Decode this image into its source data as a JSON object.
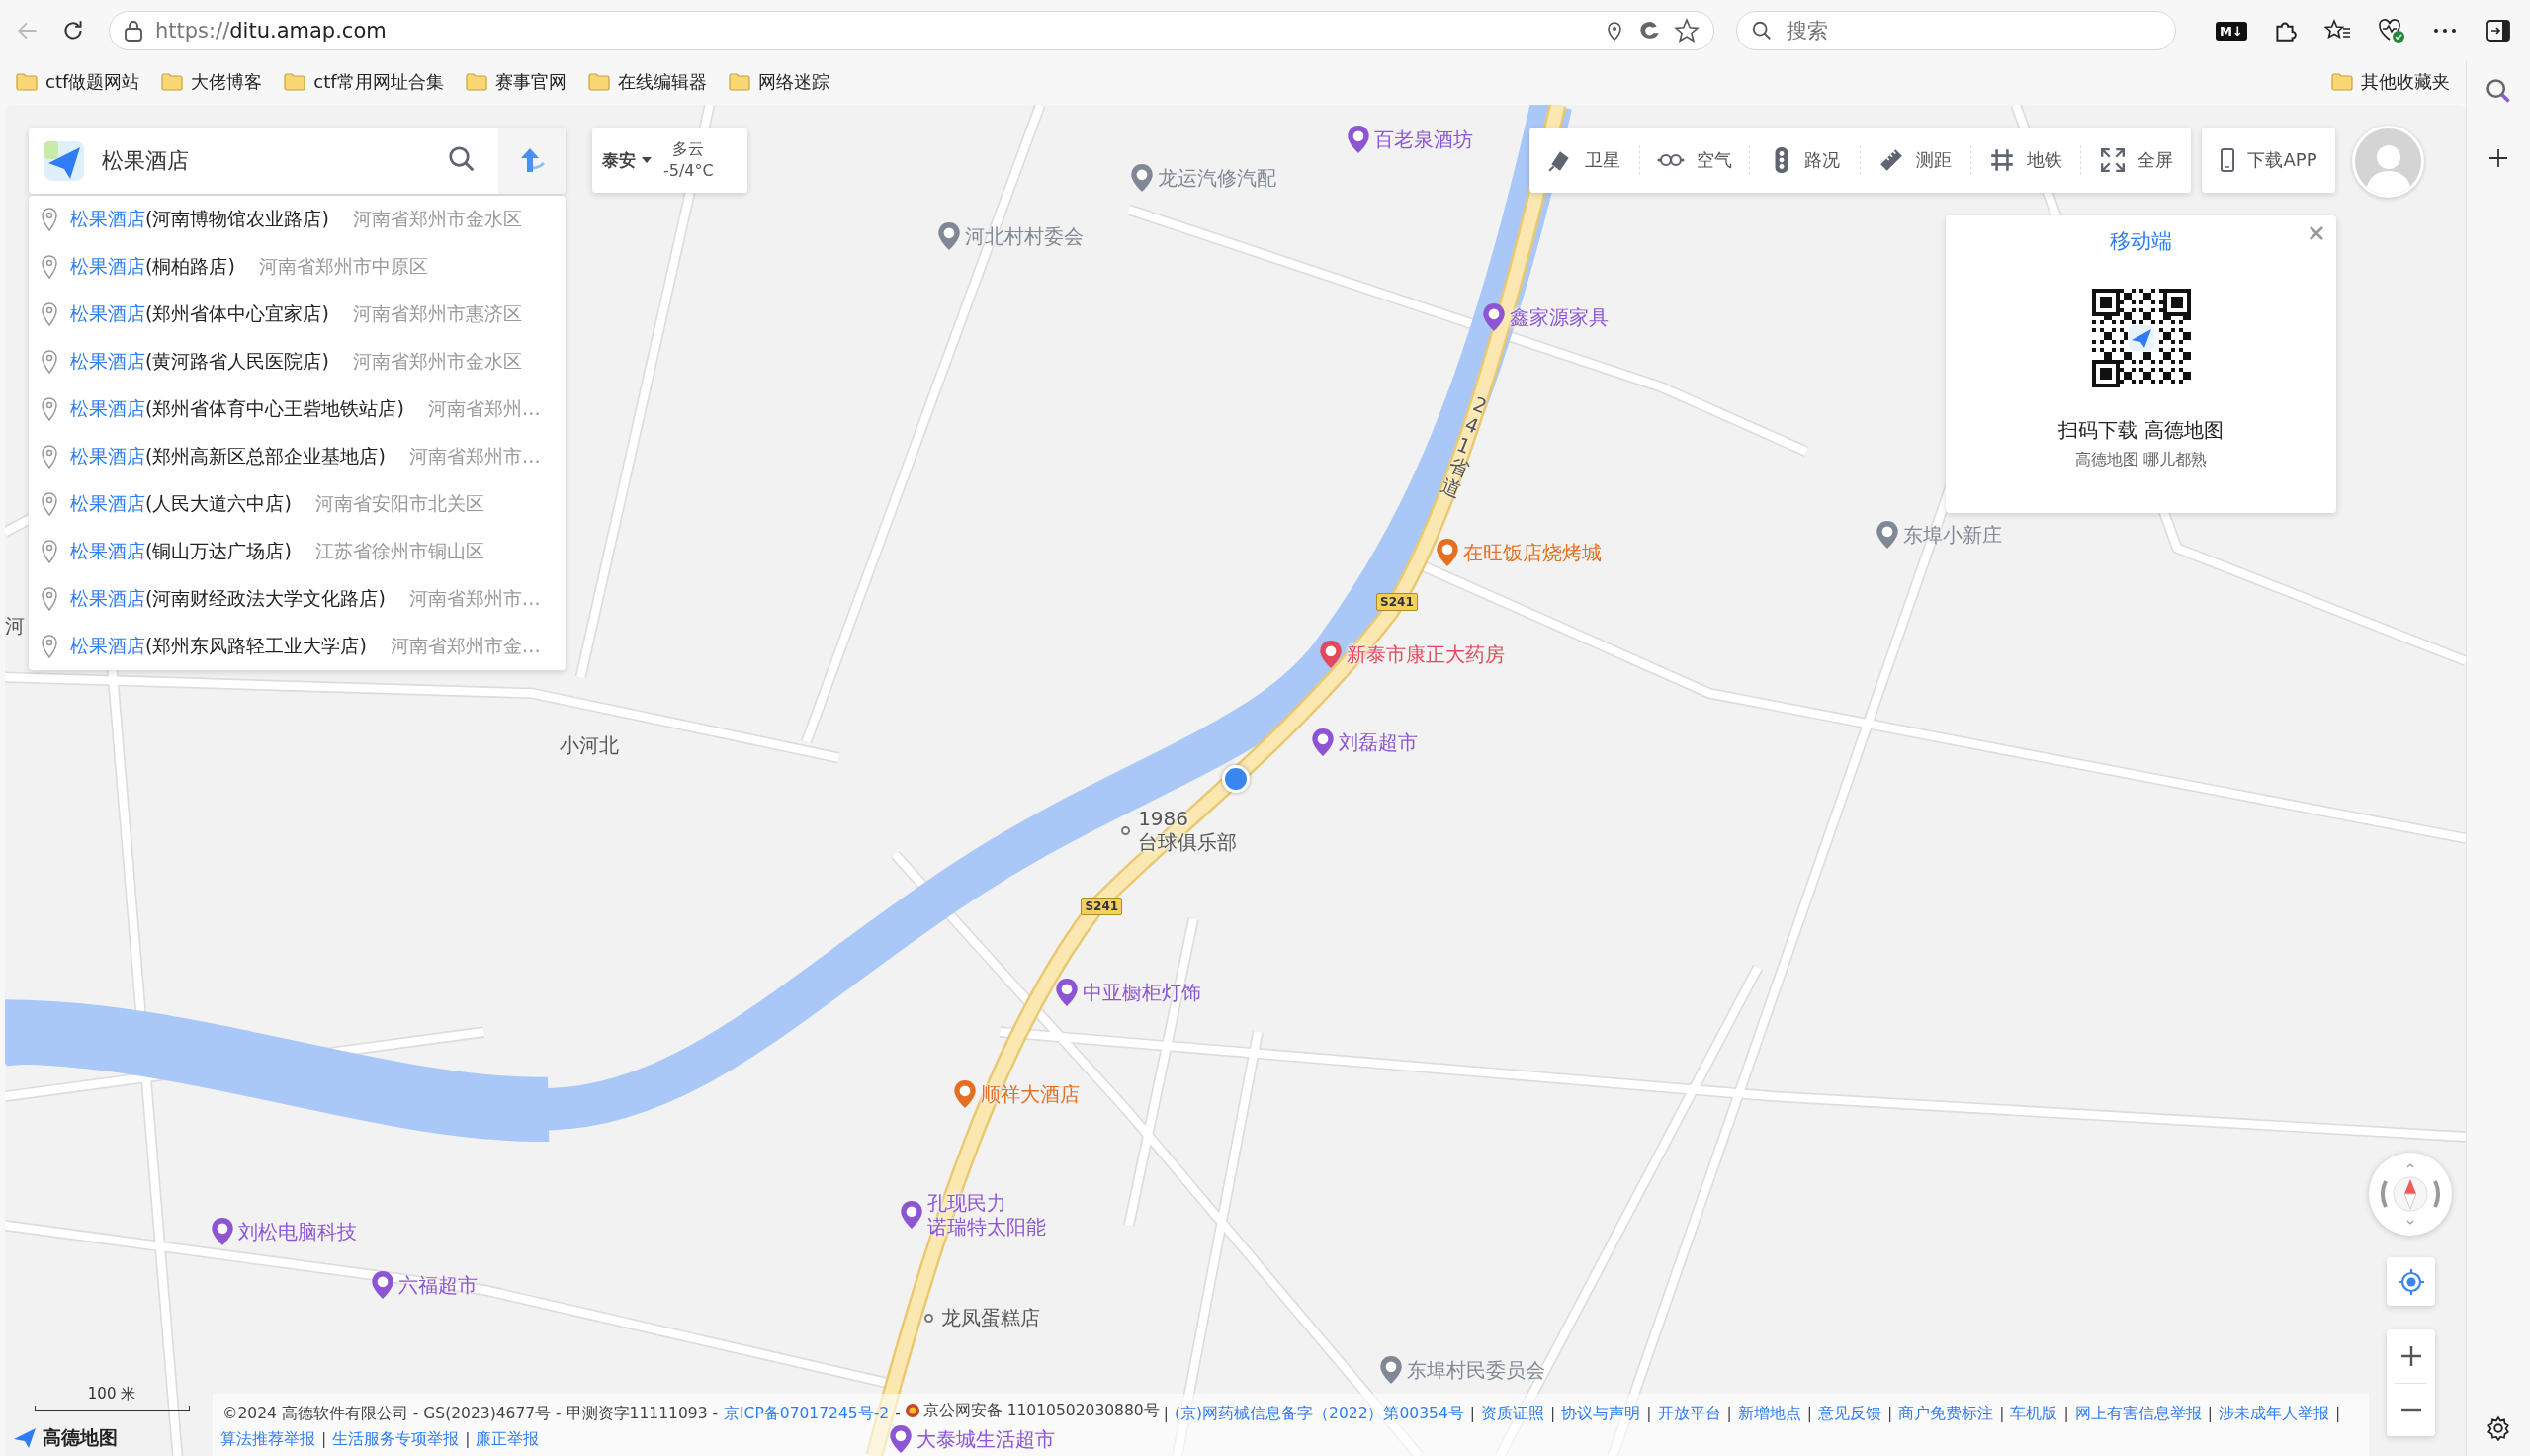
{
  "browser": {
    "back_disabled": true,
    "url_scheme": "https://",
    "url_host": "ditu.amap.com",
    "search_placeholder": "搜索",
    "extension_label": "M↓"
  },
  "bookmarks": [
    {
      "label": "ctf做题网站"
    },
    {
      "label": "大佬博客"
    },
    {
      "label": "ctf常用网址合集"
    },
    {
      "label": "赛事官网"
    },
    {
      "label": "在线编辑器"
    },
    {
      "label": "网络迷踪"
    }
  ],
  "other_bookmarks": "其他收藏夹",
  "search": {
    "value": "松果酒店"
  },
  "suggestions": [
    {
      "match": "松果酒店",
      "detail": "(河南博物馆农业路店)",
      "address": "河南省郑州市金水区"
    },
    {
      "match": "松果酒店",
      "detail": "(桐柏路店)",
      "address": "河南省郑州市中原区"
    },
    {
      "match": "松果酒店",
      "detail": "(郑州省体中心宜家店)",
      "address": "河南省郑州市惠济区"
    },
    {
      "match": "松果酒店",
      "detail": "(黄河路省人民医院店)",
      "address": "河南省郑州市金水区"
    },
    {
      "match": "松果酒店",
      "detail": "(郑州省体育中心王砦地铁站店)",
      "address": "河南省郑州…"
    },
    {
      "match": "松果酒店",
      "detail": "(郑州高新区总部企业基地店)",
      "address": "河南省郑州市…"
    },
    {
      "match": "松果酒店",
      "detail": "(人民大道六中店)",
      "address": "河南省安阳市北关区"
    },
    {
      "match": "松果酒店",
      "detail": "(铜山万达广场店)",
      "address": "江苏省徐州市铜山区"
    },
    {
      "match": "松果酒店",
      "detail": "(河南财经政法大学文化路店)",
      "address": "河南省郑州市…"
    },
    {
      "match": "松果酒店",
      "detail": "(郑州东风路轻工业大学店)",
      "address": "河南省郑州市金…"
    }
  ],
  "weather": {
    "city": "泰安",
    "condition": "多云",
    "temperature": "-5/4°C"
  },
  "toolbar": [
    {
      "kind": "satellite",
      "label": "卫星"
    },
    {
      "kind": "air",
      "label": "空气"
    },
    {
      "kind": "traffic",
      "label": "路况"
    },
    {
      "kind": "ruler",
      "label": "测距"
    },
    {
      "kind": "subway",
      "label": "地铁"
    },
    {
      "kind": "fullscreen",
      "label": "全屏"
    }
  ],
  "download_button": "下载APP",
  "qr_card": {
    "title": "移动端",
    "headline": "扫码下载 高德地图",
    "tagline": "高德地图 哪儿都熟"
  },
  "map": {
    "pois": [
      {
        "kind": "pin",
        "color": "#8d55d4",
        "lines": [
          "百老泉酒坊"
        ]
      },
      {
        "kind": "pin",
        "color": "#7f8894",
        "lines": [
          "龙运汽修汽配"
        ]
      },
      {
        "kind": "pin",
        "color": "#7f8894",
        "lines": [
          "河北村村委会"
        ]
      },
      {
        "kind": "pin",
        "color": "#8d55d4",
        "lines": [
          "鑫家源家具"
        ]
      },
      {
        "kind": "pin",
        "color": "#7f8894",
        "lines": [
          "东埠小新庄"
        ]
      },
      {
        "kind": "pin",
        "color": "#e46f22",
        "lines": [
          "在旺饭店烧烤城"
        ]
      },
      {
        "kind": "pin",
        "color": "#e3485c",
        "lines": [
          "新泰市康正大药房"
        ]
      },
      {
        "kind": "pin",
        "color": "#8d55d4",
        "lines": [
          "刘磊超市"
        ]
      },
      {
        "kind": "label",
        "lines": [
          "小河北"
        ]
      },
      {
        "kind": "dot",
        "lines": [
          "1986",
          "台球俱乐部"
        ]
      },
      {
        "kind": "pin",
        "color": "#8d55d4",
        "lines": [
          "中亚橱柜灯饰"
        ]
      },
      {
        "kind": "pin",
        "color": "#e46f22",
        "lines": [
          "顺祥大酒店"
        ]
      },
      {
        "kind": "pin",
        "color": "#8d55d4",
        "lines": [
          "刘松电脑科技"
        ]
      },
      {
        "kind": "pin",
        "color": "#8d55d4",
        "lines": [
          "孔现民力",
          "诺瑞特太阳能"
        ]
      },
      {
        "kind": "pin",
        "color": "#8d55d4",
        "lines": [
          "六福超市"
        ]
      },
      {
        "kind": "dot",
        "lines": [
          "龙凤蛋糕店"
        ]
      },
      {
        "kind": "pin",
        "color": "#7f8894",
        "lines": [
          "东埠村民委员会"
        ]
      },
      {
        "kind": "pin",
        "color": "#8d55d4",
        "lines": [
          "大泰城生活超市"
        ]
      },
      {
        "kind": "label",
        "lines": [
          "河"
        ]
      }
    ],
    "road_shields": [
      "S241",
      "S241"
    ],
    "road_name": "241省道",
    "scale": "100 米"
  },
  "logo": "高德地图",
  "footer": [
    {
      "kind": "text",
      "text": "©2024 高德软件有限公司 - GS(2023)4677号 - 甲测资字11111093 -"
    },
    {
      "kind": "link",
      "text": "京ICP备07017245号-2"
    },
    {
      "kind": "text",
      "text": "-"
    },
    {
      "kind": "police",
      "text": "京公网安备 11010502030880号"
    },
    {
      "kind": "text",
      "text": "|"
    },
    {
      "kind": "link",
      "text": "(京)网药械信息备字（2022）第00354号"
    },
    {
      "kind": "text",
      "text": "|"
    },
    {
      "kind": "link",
      "text": "资质证照"
    },
    {
      "kind": "text",
      "text": "|"
    },
    {
      "kind": "link",
      "text": "协议与声明"
    },
    {
      "kind": "text",
      "text": "|"
    },
    {
      "kind": "link",
      "text": "开放平台"
    },
    {
      "kind": "text",
      "text": "|"
    },
    {
      "kind": "link",
      "text": "新增地点"
    },
    {
      "kind": "text",
      "text": "|"
    },
    {
      "kind": "link",
      "text": "意见反馈"
    },
    {
      "kind": "text",
      "text": "|"
    },
    {
      "kind": "link",
      "text": "商户免费标注"
    },
    {
      "kind": "text",
      "text": "|"
    },
    {
      "kind": "link",
      "text": "车机版"
    },
    {
      "kind": "text",
      "text": "|"
    },
    {
      "kind": "link",
      "text": "网上有害信息举报"
    },
    {
      "kind": "text",
      "text": "|"
    },
    {
      "kind": "link",
      "text": "涉未成年人举报"
    },
    {
      "kind": "text",
      "text": "|"
    },
    {
      "kind": "link",
      "text": "算法推荐举报"
    },
    {
      "kind": "text",
      "text": "|"
    },
    {
      "kind": "link",
      "text": "生活服务专项举报"
    },
    {
      "kind": "text",
      "text": "|"
    },
    {
      "kind": "link",
      "text": "廉正举报"
    }
  ]
}
